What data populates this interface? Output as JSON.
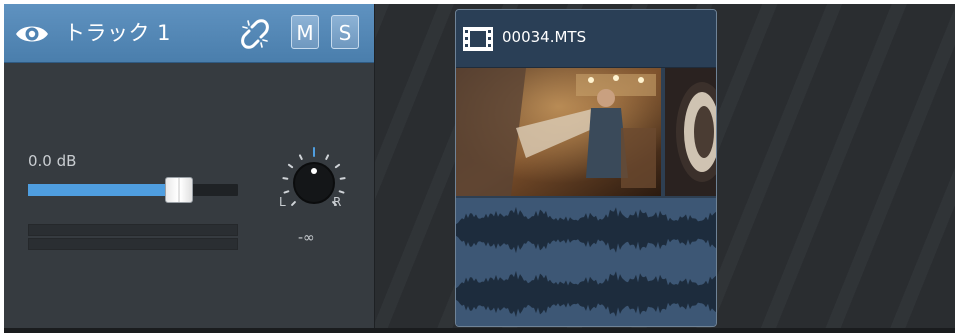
{
  "track": {
    "name": "トラック 1",
    "mute_label": "M",
    "solo_label": "S",
    "gain_label": "0.0 dB",
    "volume_fraction": 0.72,
    "pan": {
      "left_label": "L",
      "right_label": "R",
      "value_label": "-∞",
      "position": 0.5
    },
    "icons": {
      "visibility": "eye-icon",
      "link": "unlink-icon"
    }
  },
  "clip": {
    "name": "00034.MTS",
    "icon": "film-icon",
    "thumbnail_count": 2
  },
  "colors": {
    "header_blue": "#5a8cbb",
    "fader_fill": "#4f9ee0",
    "clip_body": "#3d5775",
    "background": "#2b2f33"
  }
}
